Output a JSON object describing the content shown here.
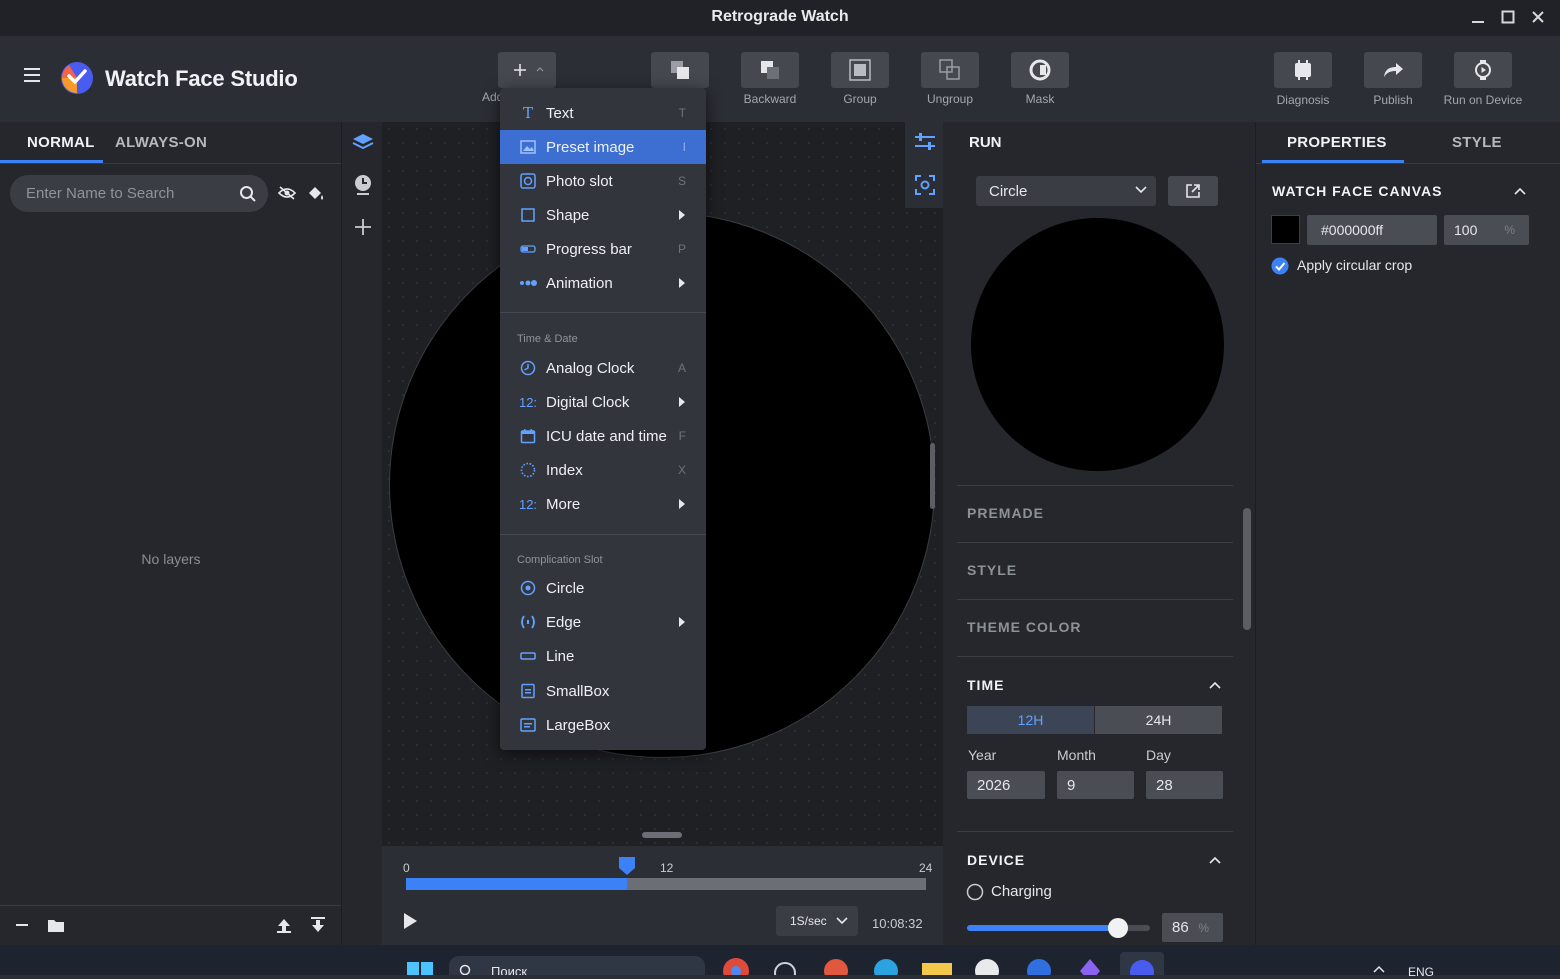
{
  "window": {
    "title": "Retrograde Watch"
  },
  "app": {
    "name": "Watch Face Studio"
  },
  "toolbar": {
    "add_label": "Add",
    "backward_label": "Backward",
    "group_label": "Group",
    "ungroup_label": "Ungroup",
    "mask_label": "Mask",
    "diagnosis_label": "Diagnosis",
    "publish_label": "Publish",
    "run_on_device_label": "Run on Device"
  },
  "layers": {
    "tab_normal": "NORMAL",
    "tab_always_on": "ALWAYS-ON",
    "search_placeholder": "Enter Name to Search",
    "empty_text": "No layers"
  },
  "add_menu": {
    "items": [
      {
        "label": "Text",
        "shortcut": "T",
        "icon": "text-icon"
      },
      {
        "label": "Preset image",
        "shortcut": "I",
        "icon": "image-icon"
      },
      {
        "label": "Photo slot",
        "shortcut": "S",
        "icon": "photo-slot-icon"
      },
      {
        "label": "Shape",
        "icon": "square-icon"
      },
      {
        "label": "Progress bar",
        "shortcut": "P",
        "icon": "progress-bar-icon"
      },
      {
        "label": "Animation",
        "icon": "animation-icon"
      }
    ],
    "time_date_header": "Time & Date",
    "time_date_items": [
      {
        "label": "Analog Clock",
        "shortcut": "A",
        "icon": "analog-clock-icon"
      },
      {
        "label": "Digital Clock",
        "icon": "digital-clock-icon",
        "icon_text": "12:"
      },
      {
        "label": "ICU date and time",
        "shortcut": "F",
        "icon": "calendar-icon"
      },
      {
        "label": "Index",
        "shortcut": "X",
        "icon": "index-icon"
      },
      {
        "label": "More",
        "icon": "more-icon",
        "icon_text": "12:"
      }
    ],
    "complication_header": "Complication Slot",
    "complication_items": [
      {
        "label": "Circle",
        "icon": "circle-slot-icon"
      },
      {
        "label": "Edge",
        "icon": "edge-icon"
      },
      {
        "label": "Line",
        "icon": "line-icon"
      },
      {
        "label": "SmallBox",
        "icon": "smallbox-icon"
      },
      {
        "label": "LargeBox",
        "icon": "largebox-icon"
      }
    ]
  },
  "timeline": {
    "tick_start": "0",
    "tick_mid": "12",
    "tick_end": "24",
    "position_fraction": 0.425,
    "speed": "1S/sec",
    "time": "10:08:32"
  },
  "run": {
    "title": "RUN",
    "shape_selected": "Circle",
    "premade_label": "PREMADE",
    "style_label": "STYLE",
    "theme_color_label": "THEME COLOR",
    "time_label": "TIME",
    "format_12h": "12H",
    "format_24h": "24H",
    "year_label": "Year",
    "month_label": "Month",
    "day_label": "Day",
    "year": "2026",
    "month": "9",
    "day": "28",
    "device_label": "DEVICE",
    "charging_label": "Charging",
    "battery": "86",
    "battery_unit": "%",
    "battery_fraction": 0.86
  },
  "properties": {
    "tab_properties": "PROPERTIES",
    "tab_style": "STYLE",
    "section_title": "WATCH FACE CANVAS",
    "color_hex": "#000000ff",
    "opacity": "100",
    "opacity_unit": "%",
    "circular_crop_label": "Apply circular crop"
  },
  "taskbar": {
    "search_text": "Поиск",
    "lang": "ENG"
  },
  "colors": {
    "accent": "#3c82f6",
    "menu_selected": "#3c6fd1",
    "icon_blue": "#62a1ff"
  }
}
